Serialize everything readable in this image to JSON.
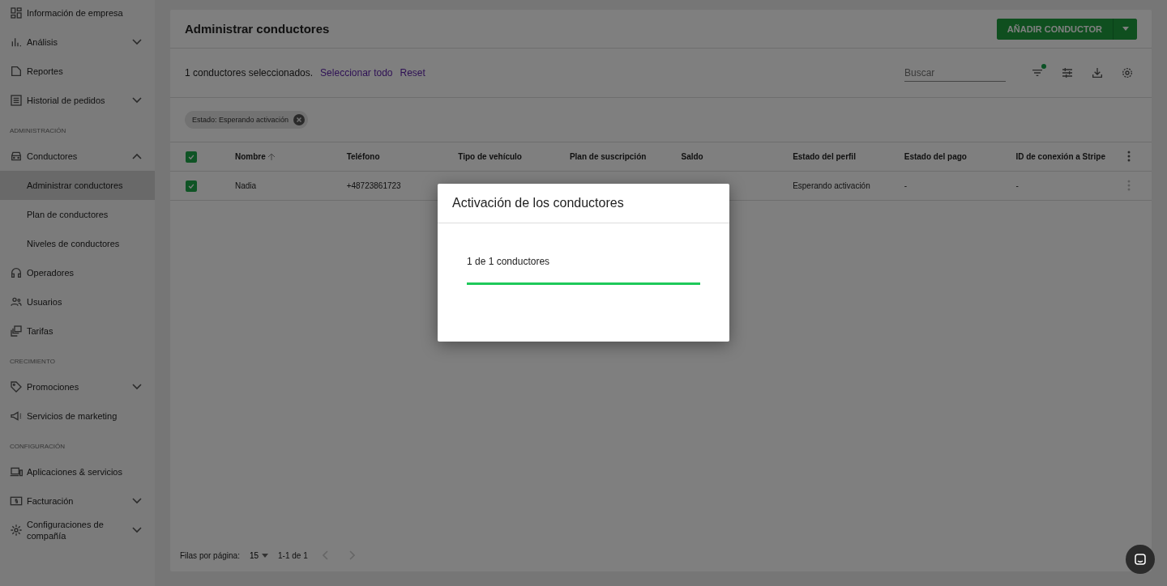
{
  "sidebar": {
    "groups": [
      {
        "items": [
          {
            "label": "Información de empresa",
            "selected": false
          },
          {
            "label": "Análisis",
            "selected": false,
            "expanded": false
          },
          {
            "label": "Reportes",
            "selected": false
          },
          {
            "label": "Historial de pedidos",
            "selected": false,
            "expanded": false
          }
        ]
      },
      {
        "heading": "ADMINISTRACIÓN",
        "items": [
          {
            "label": "Conductores",
            "selected": false,
            "expanded": true,
            "children": [
              {
                "label": "Administrar conductores",
                "selected": true
              },
              {
                "label": "Plan de conductores",
                "selected": false
              },
              {
                "label": "Niveles de conductores",
                "selected": false
              }
            ]
          },
          {
            "label": "Operadores",
            "selected": false
          },
          {
            "label": "Usuarios",
            "selected": false
          },
          {
            "label": "Tarifas",
            "selected": false
          }
        ]
      },
      {
        "heading": "CRECIMIENTO",
        "items": [
          {
            "label": "Promociones",
            "selected": false,
            "expanded": false
          },
          {
            "label": "Servicios de marketing",
            "selected": false
          }
        ]
      },
      {
        "heading": "CONFIGURACIÓN",
        "items": [
          {
            "label": "Aplicaciones & servicios",
            "selected": false
          },
          {
            "label": "Facturación",
            "selected": false,
            "expanded": false
          },
          {
            "label": "Configuraciones de compañía",
            "selected": false,
            "expanded": false
          }
        ]
      }
    ]
  },
  "page": {
    "title": "Administrar conductores",
    "add_button": "AÑADIR CONDUCTOR",
    "selection": {
      "text": "1 conductores seleccionados.",
      "links": [
        "Seleccionar todo",
        "Reset"
      ]
    },
    "search": {
      "placeholder": "Buscar"
    },
    "filter_active": true,
    "chips": [
      {
        "label": "Estado: Esperando activación"
      }
    ],
    "table": {
      "all_checked": true,
      "columns": [
        {
          "label": "Nombre",
          "sorted": true
        },
        {
          "label": "Teléfono"
        },
        {
          "label": "Tipo de vehículo"
        },
        {
          "label": "Plan de suscripción"
        },
        {
          "label": "Saldo"
        },
        {
          "label": "Estado del perfil"
        },
        {
          "label": "Estado del pago"
        },
        {
          "label": "ID de conexión a Stripe"
        }
      ],
      "rows": [
        {
          "checked": true,
          "cells": [
            "Nadia",
            "+48723861723",
            null,
            null,
            null,
            "Esperando activación",
            "-",
            "-"
          ]
        }
      ]
    },
    "footer": {
      "rows_label": "Filas por página:",
      "rows_per_page": "15",
      "range": "1-1 de 1",
      "prev_disabled": true,
      "next_disabled": true
    }
  },
  "dialog": {
    "title": "Activación de los conductores",
    "progress_text": "1 de 1 conductores",
    "level": 1
  }
}
